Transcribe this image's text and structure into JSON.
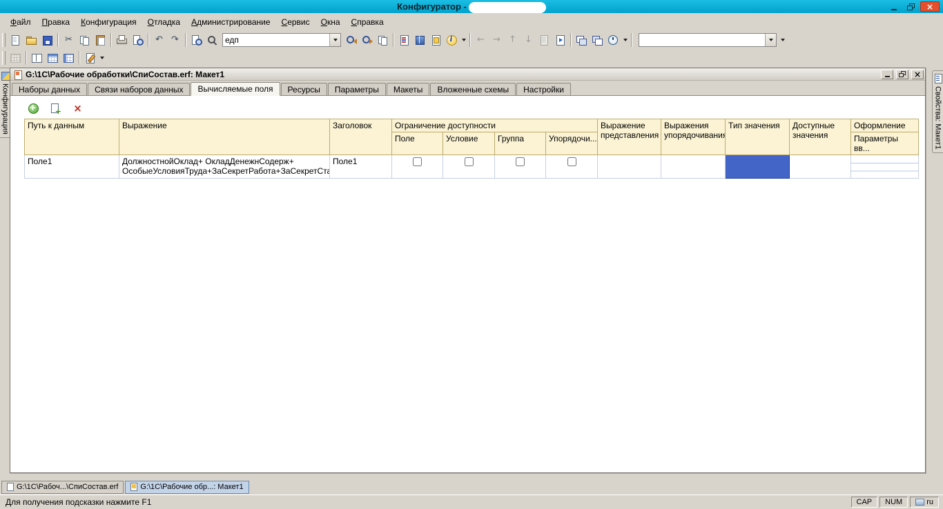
{
  "titlebar": {
    "title": "Конфигуратор - "
  },
  "menu": {
    "items": [
      "Файл",
      "Правка",
      "Конфигурация",
      "Отладка",
      "Администрирование",
      "Сервис",
      "Окна",
      "Справка"
    ]
  },
  "toolbar": {
    "search_value": "едп",
    "context_value": ""
  },
  "side_tabs": {
    "left": "Конфигурация",
    "right": "Свойства: Макет1"
  },
  "mdi": {
    "title": "G:\\1C\\Рабочие обработки\\СпиСостав.erf: Макет1",
    "tabs": [
      "Наборы данных",
      "Связи наборов данных",
      "Вычисляемые поля",
      "Ресурсы",
      "Параметры",
      "Макеты",
      "Вложенные схемы",
      "Настройки"
    ],
    "active_tab": "Вычисляемые поля"
  },
  "grid": {
    "headers": {
      "path": "Путь к данным",
      "expression": "Выражение",
      "title": "Заголовок",
      "availability": "Ограничение доступности",
      "avail_field": "Поле",
      "avail_condition": "Условие",
      "avail_group": "Группа",
      "avail_order": "Упорядочи...",
      "presentation": "Выражение представления",
      "ordering": "Выражения упорядочивания",
      "value_type": "Тип значения",
      "available_values": "Доступные значения",
      "appearance": "Оформление",
      "appearance_sub": "Параметры вв..."
    },
    "row": {
      "path": "Поле1",
      "expression_line1": "ДолжностнойОклад+ ОкладДенежнСодерж+",
      "expression_line2": "ОсобыеУсловияТруда+ЗаСекретРабота+ЗаСекретСта...",
      "title": "Поле1",
      "checkboxes": [
        false,
        false,
        false,
        false
      ],
      "selected_cell": "Тип значения"
    }
  },
  "bottom_tabs": [
    {
      "label": "G:\\1C\\Рабоч...\\СпиСостав.erf"
    },
    {
      "label": "G:\\1C\\Рабочие обр...: Макет1"
    }
  ],
  "status": {
    "message": "Для получения подсказки нажмите F1",
    "cap": "CAP",
    "num": "NUM",
    "lang": "ru"
  },
  "colors": {
    "titlebar": "#00A8D0",
    "close_button": "#E4502E",
    "selected_cell": "#4465C8",
    "grid_header_bg": "#FBF3D4",
    "grid_header_border": "#BCAB6E"
  }
}
